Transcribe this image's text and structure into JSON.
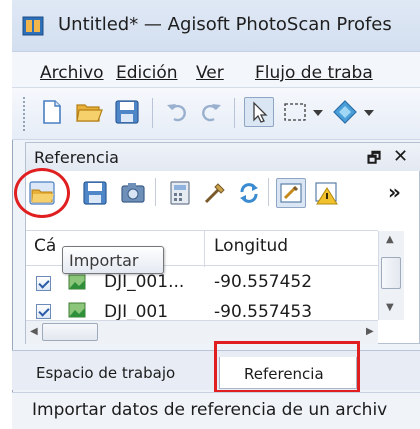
{
  "window": {
    "title": "Untitled* — Agisoft PhotoScan Profes"
  },
  "menu": {
    "items": [
      {
        "label": "Archivo"
      },
      {
        "label": "Edición"
      },
      {
        "label": "Ver"
      },
      {
        "label": "Flujo de traba"
      }
    ]
  },
  "toolbar": {
    "icons": [
      "new-document-icon",
      "open-folder-icon",
      "save-icon",
      "undo-icon",
      "redo-icon",
      "select-pointer-icon",
      "rectangle-select-icon",
      "dropdown-arrow-icon",
      "navigate-icon"
    ]
  },
  "reference_pane": {
    "title": "Referencia",
    "float_symbol": "🗗",
    "close_symbol": "✕",
    "tooltip": "Importar",
    "overflow": "»",
    "toolbar_icons": [
      "import-icon",
      "export-icon",
      "camera-settings-icon",
      "calculator-icon",
      "optimize-icon",
      "update-icon",
      "view-source-icon",
      "view-errors-icon"
    ],
    "columns": [
      "Cá",
      "Longitud"
    ],
    "rows": [
      {
        "camera": "DJI_001...",
        "longitude": "-90.557452",
        "checked": true
      },
      {
        "camera": "DJI_001",
        "longitude": "-90.557453",
        "checked": true
      }
    ]
  },
  "tabs": {
    "items": [
      {
        "label": "Espacio de trabajo",
        "active": false
      },
      {
        "label": "Referencia",
        "active": true
      }
    ]
  },
  "status": {
    "text": "Importar datos de referencia de un archiv"
  },
  "colors": {
    "highlight": "#e02020",
    "accent_blue": "#2b5aa8",
    "panel_bg": "#eef3fa"
  }
}
